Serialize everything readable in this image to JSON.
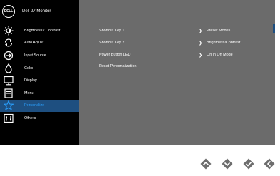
{
  "brand": {
    "logo_text": "DELL",
    "title": "Dell 27 Monitor"
  },
  "menu": [
    {
      "label": "Brightness / Contrast",
      "icon": "brightness-icon"
    },
    {
      "label": "Auto Adjust",
      "icon": "auto-adjust-icon"
    },
    {
      "label": "Input Source",
      "icon": "input-source-icon"
    },
    {
      "label": "Color",
      "icon": "color-icon"
    },
    {
      "label": "Display",
      "icon": "display-icon"
    },
    {
      "label": "Menu",
      "icon": "menu-icon"
    },
    {
      "label": "Personalize",
      "icon": "star-icon",
      "active": true
    },
    {
      "label": "Others",
      "icon": "others-icon"
    }
  ],
  "settings": [
    {
      "label": "Shortcut Key 1",
      "value": "Preset Modes"
    },
    {
      "label": "Shortcut Key 2",
      "value": "Brightness/Contrast"
    },
    {
      "label": "Power Button LED",
      "value": "On in On Mode"
    },
    {
      "label": "Reset Personalization",
      "value": ""
    }
  ],
  "nav_buttons": [
    "up-arrow-icon",
    "down-arrow-icon",
    "check-icon",
    "back-icon"
  ],
  "colors": {
    "osd_bg": "#6b6b6b",
    "sidebar_bg": "#000000",
    "active_bg": "#1e4f80",
    "active_text": "#2aa1ff",
    "nav_button": "#6d6d6d"
  }
}
